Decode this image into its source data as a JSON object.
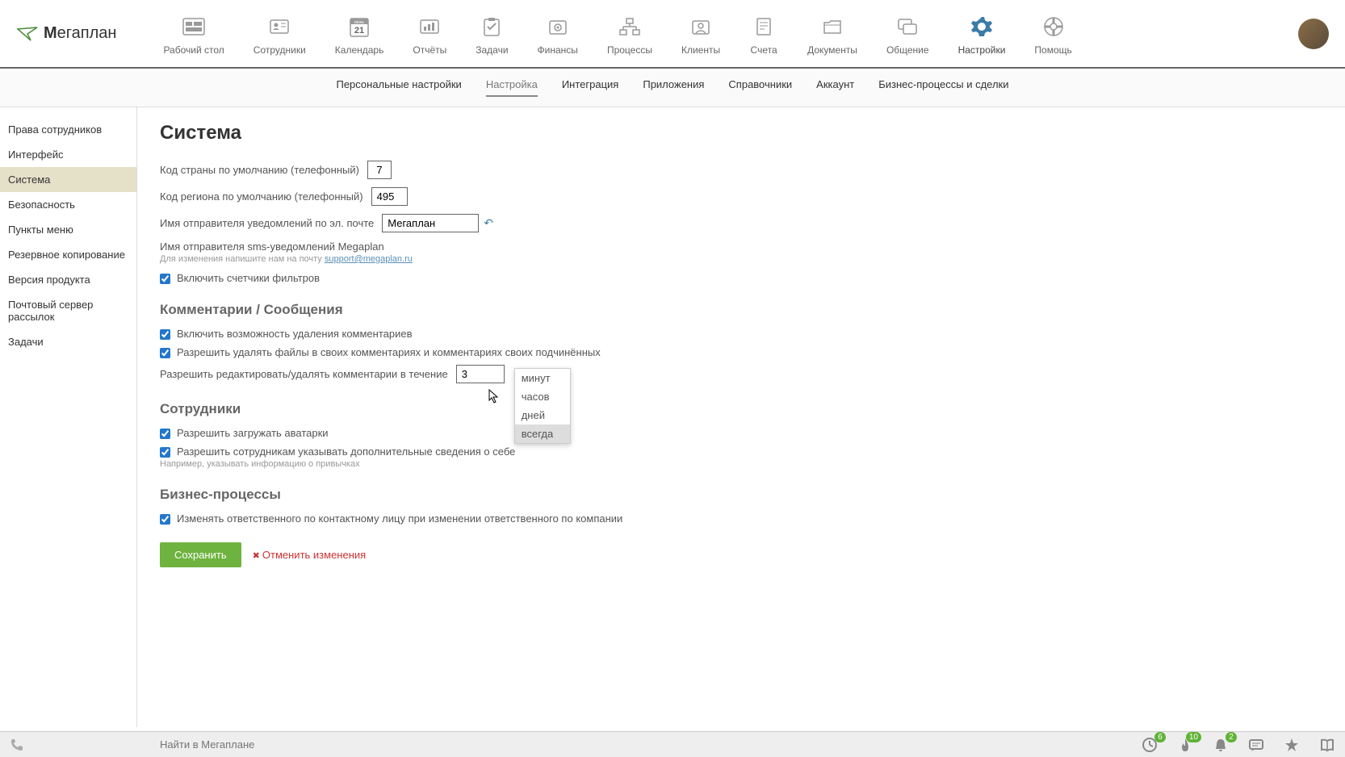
{
  "logo": {
    "text": "егаплан"
  },
  "topNav": [
    {
      "label": "Рабочий стол"
    },
    {
      "label": "Сотрудники"
    },
    {
      "label": "Календарь",
      "sub": "июнь",
      "day": "21"
    },
    {
      "label": "Отчёты"
    },
    {
      "label": "Задачи"
    },
    {
      "label": "Финансы"
    },
    {
      "label": "Процессы"
    },
    {
      "label": "Клиенты"
    },
    {
      "label": "Счета"
    },
    {
      "label": "Документы"
    },
    {
      "label": "Общение"
    },
    {
      "label": "Настройки"
    },
    {
      "label": "Помощь"
    }
  ],
  "subNav": [
    "Персональные настройки",
    "Настройка",
    "Интеграция",
    "Приложения",
    "Справочники",
    "Аккаунт",
    "Бизнес-процессы и сделки"
  ],
  "sidebar": [
    "Права сотрудников",
    "Интерфейс",
    "Система",
    "Безопасность",
    "Пункты меню",
    "Резервное копирование",
    "Версия продукта",
    "Почтовый сервер рассылок",
    "Задачи"
  ],
  "page": {
    "title": "Система",
    "countryCodeLabel": "Код страны по умолчанию (телефонный)",
    "countryCode": "7",
    "regionCodeLabel": "Код региона по умолчанию (телефонный)",
    "regionCode": "495",
    "emailSenderLabel": "Имя отправителя уведомлений по эл. почте",
    "emailSender": "Мегаплан",
    "smsSenderLabel": "Имя отправителя sms-уведомлений Megaplan",
    "smsHint": "Для изменения напишите нам на почту ",
    "smsHintLink": "support@megaplan.ru",
    "filterCountersLabel": "Включить счетчики фильтров",
    "commentsSection": "Комментарии / Сообщения",
    "enableDeleteLabel": "Включить возможность удаления комментариев",
    "allowDeleteFilesLabel": "Разрешить удалять файлы в своих комментариях и комментариях своих подчинённых",
    "editTimeLabel": "Разрешить редактировать/удалять комментарии в течение",
    "editTimeValue": "3",
    "editTimeUnit": "минут",
    "unitOptions": [
      "минут",
      "часов",
      "дней",
      "всегда"
    ],
    "employeesSection": "Сотрудники",
    "allowAvatarsLabel": "Разрешить загружать аватарки",
    "allowExtraInfoLabel": "Разрешить сотрудникам указывать дополнительные сведения о себе",
    "allowExtraInfoHint": "Например, указывать информацию о привычках",
    "bpSection": "Бизнес-процессы",
    "bpResponsibleLabel": "Изменять ответственного по контактному лицу при изменении ответственного по компании",
    "saveLabel": "Сохранить",
    "cancelLabel": "Отменить изменения"
  },
  "footer": {
    "searchPlaceholder": "Найти в Мегаплане",
    "badges": {
      "clock": "6",
      "fire": "10",
      "bell": "2"
    }
  }
}
